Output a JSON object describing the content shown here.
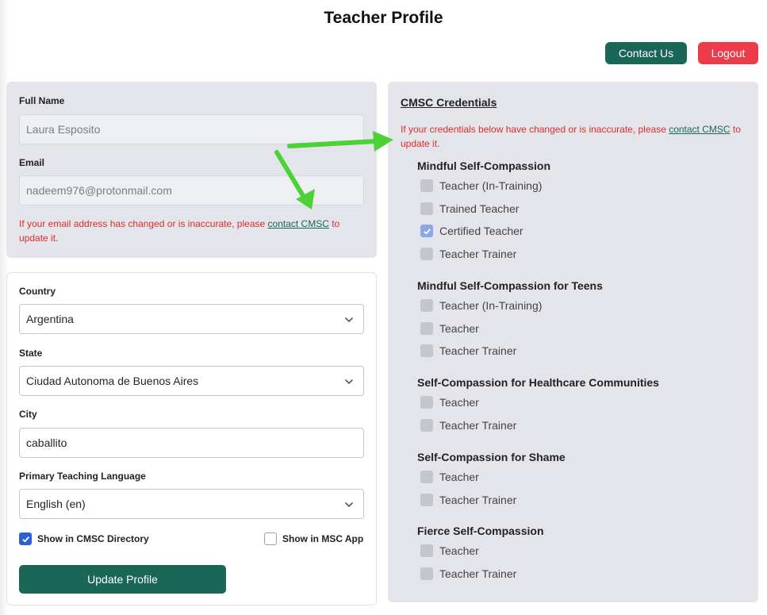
{
  "page": {
    "title": "Teacher Profile"
  },
  "header": {
    "contact_label": "Contact Us",
    "logout_label": "Logout"
  },
  "identity": {
    "full_name_label": "Full Name",
    "full_name_value": "Laura Esposito",
    "email_label": "Email",
    "email_value": "nadeem976@protonmail.com",
    "email_note_prefix": "If your email address has changed or is inaccurate, please ",
    "email_note_link": "contact CMSC",
    "email_note_suffix": " to update it."
  },
  "location": {
    "country_label": "Country",
    "country_value": "Argentina",
    "state_label": "State",
    "state_value": "Ciudad Autonoma de Buenos Aires",
    "city_label": "City",
    "city_value": "caballito",
    "language_label": "Primary Teaching Language",
    "language_value": "English (en)",
    "directory_label": "Show in CMSC Directory",
    "directory_checked": true,
    "app_label": "Show in MSC App",
    "app_checked": false,
    "update_label": "Update Profile"
  },
  "credentials": {
    "title": "CMSC Credentials",
    "note_prefix": "If your credentials below have changed or is inaccurate, please ",
    "note_link": "contact CMSC",
    "note_suffix": " to update it.",
    "groups": [
      {
        "title": "Mindful Self-Compassion",
        "items": [
          {
            "label": "Teacher (In-Training)",
            "checked": false
          },
          {
            "label": "Trained Teacher",
            "checked": false
          },
          {
            "label": "Certified Teacher",
            "checked": true
          },
          {
            "label": "Teacher Trainer",
            "checked": false
          }
        ]
      },
      {
        "title": "Mindful Self-Compassion for Teens",
        "items": [
          {
            "label": "Teacher (In-Training)",
            "checked": false
          },
          {
            "label": "Teacher",
            "checked": false
          },
          {
            "label": "Teacher Trainer",
            "checked": false
          }
        ]
      },
      {
        "title": "Self-Compassion for Healthcare Communities",
        "items": [
          {
            "label": "Teacher",
            "checked": false
          },
          {
            "label": "Teacher Trainer",
            "checked": false
          }
        ]
      },
      {
        "title": "Self-Compassion for Shame",
        "items": [
          {
            "label": "Teacher",
            "checked": false
          },
          {
            "label": "Teacher Trainer",
            "checked": false
          }
        ]
      },
      {
        "title": "Fierce Self-Compassion",
        "items": [
          {
            "label": "Teacher",
            "checked": false
          },
          {
            "label": "Teacher Trainer",
            "checked": false
          }
        ]
      }
    ]
  },
  "colors": {
    "primary": "#1a6657",
    "danger": "#ec3c49",
    "note_red": "#e02b2b",
    "panel_gray": "#e4e5ea",
    "annotation_arrow": "#4cd137"
  }
}
